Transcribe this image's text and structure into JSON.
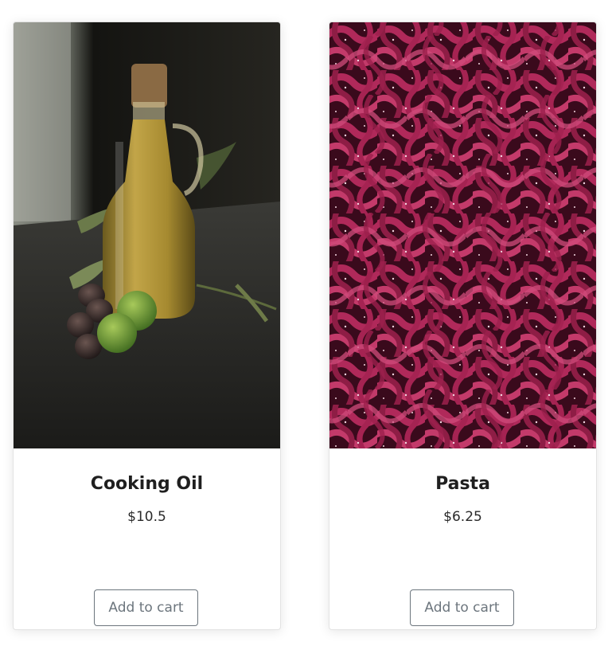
{
  "products": [
    {
      "name": "Cooking Oil",
      "price": "$10.5",
      "button_label": "Add to cart",
      "image_subject": "olive oil bottle with olives"
    },
    {
      "name": "Pasta",
      "price": "$6.25",
      "button_label": "Add to cart",
      "image_subject": "beetroot pasta ribbons"
    }
  ],
  "colors": {
    "title": "#1f1f1f",
    "button_border": "#6c757d",
    "pasta": "#a3244f",
    "oil": "#b89a3a"
  }
}
